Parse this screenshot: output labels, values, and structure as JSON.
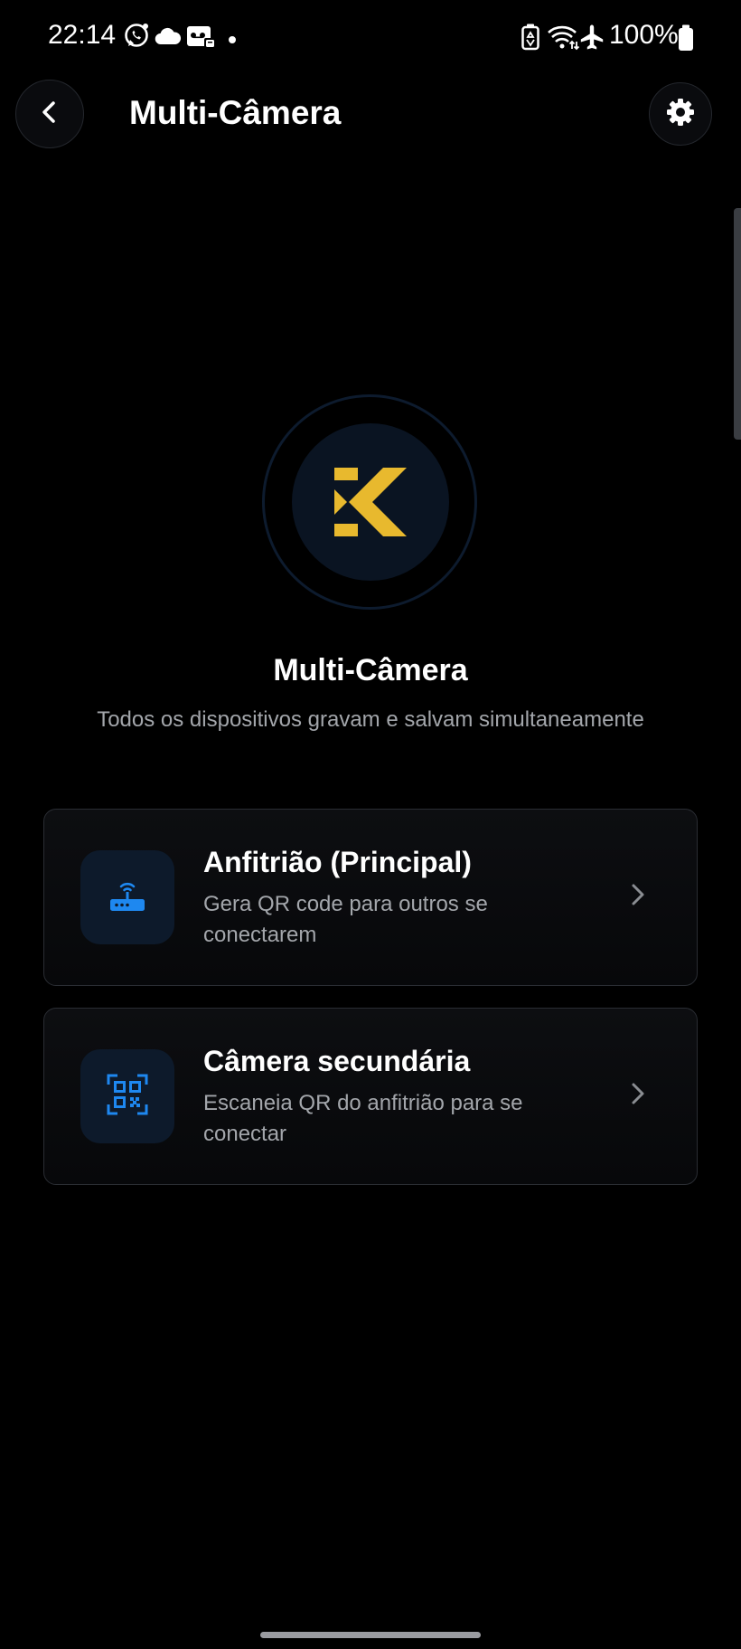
{
  "status_bar": {
    "time": "22:14",
    "battery": "100%",
    "left_icons": [
      "whatsapp-icon",
      "cloud-icon",
      "voicemail-icon",
      "dot-icon"
    ],
    "right_icons": [
      "battery-saver-icon",
      "wifi-icon",
      "airplane-icon",
      "battery-icon"
    ]
  },
  "header": {
    "title": "Multi-Câmera",
    "back_icon": "chevron-left-icon",
    "settings_icon": "gear-icon"
  },
  "hero": {
    "title": "Multi-Câmera",
    "subtitle": "Todos os dispositivos gravam e salvam simultaneamente",
    "logo_color": "#E8B92E"
  },
  "options": [
    {
      "title": "Anfitrião (Principal)",
      "description": "Gera QR code para outros se conectarem",
      "icon": "router-icon"
    },
    {
      "title": "Câmera secundária",
      "description": "Escaneia QR do anfitrião para se conectar",
      "icon": "qr-scan-icon"
    }
  ],
  "colors": {
    "background": "#000000",
    "accent_blue": "#1E88F0",
    "logo_gold": "#E8B92E",
    "secondary_text": "#A3A6AB"
  }
}
